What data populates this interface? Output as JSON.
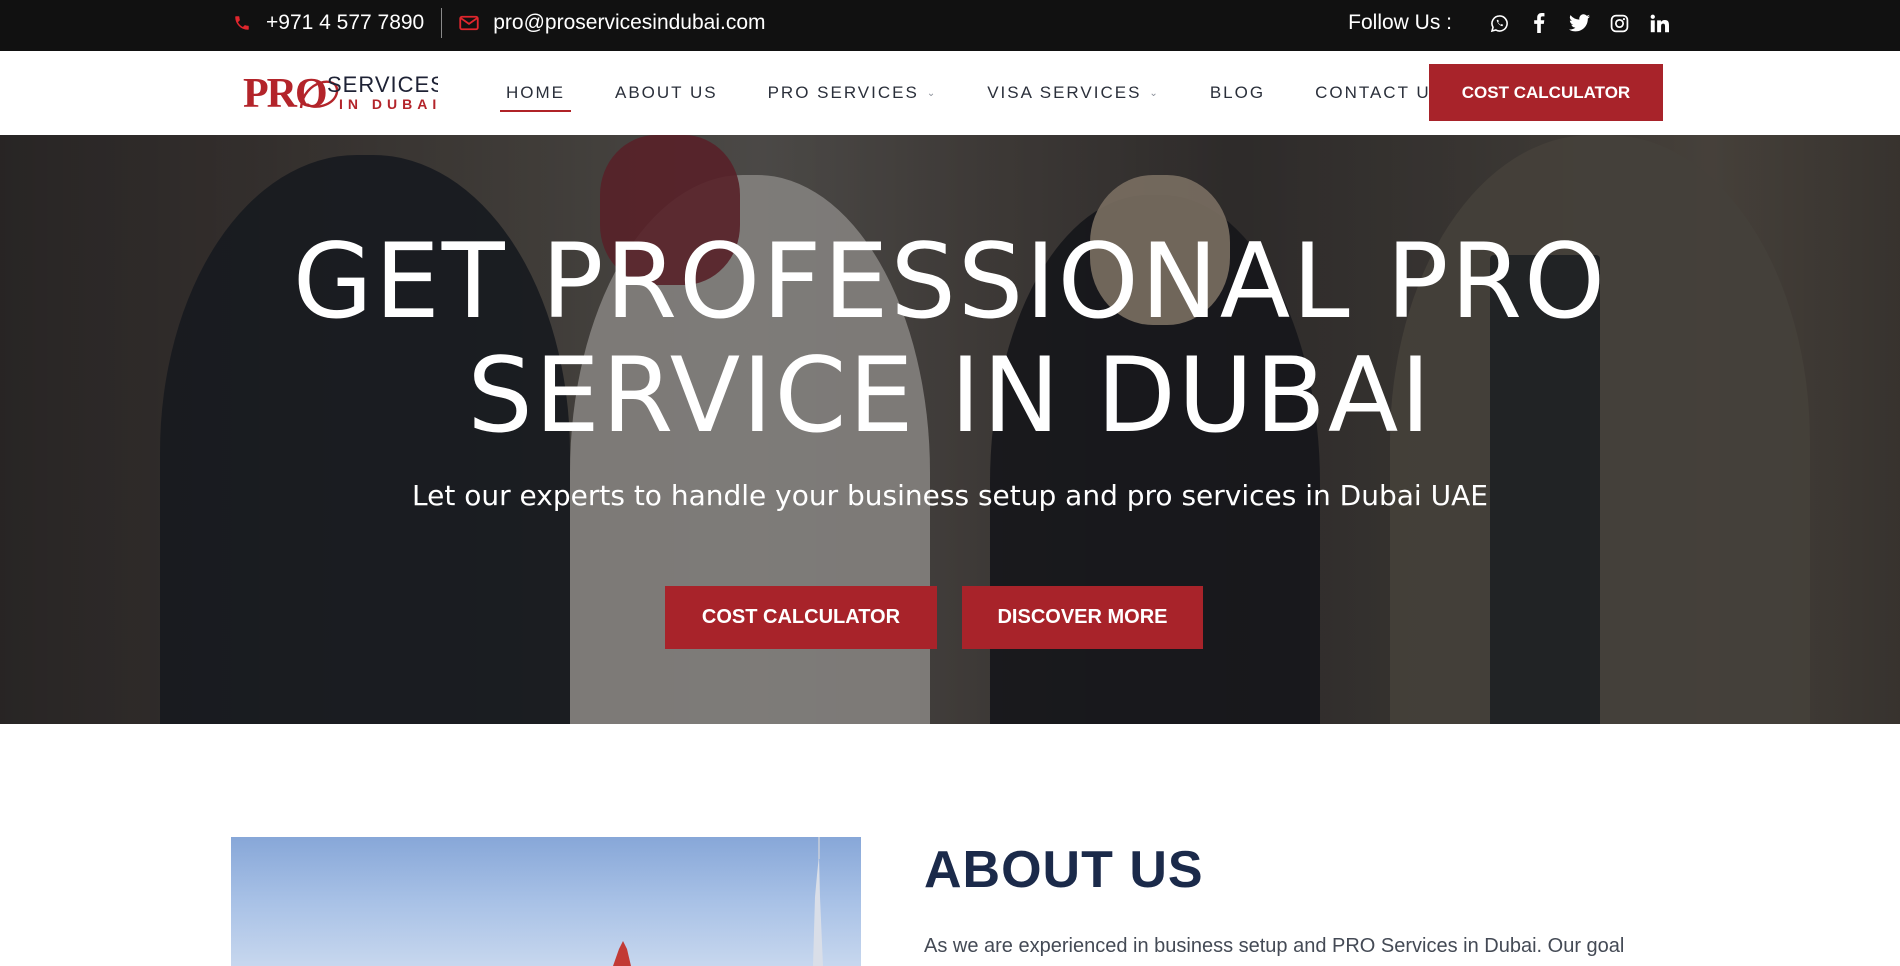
{
  "topbar": {
    "phone": "+971 4 577 7890",
    "email": "pro@proservicesindubai.com",
    "follow_label": "Follow Us :",
    "social_icons": [
      "whatsapp-icon",
      "facebook-icon",
      "twitter-icon",
      "instagram-icon",
      "linkedin-icon"
    ]
  },
  "logo": {
    "mark": "PRO",
    "line1": "SERVICES",
    "line2": "IN DUBAI"
  },
  "nav": {
    "items": [
      {
        "label": "HOME",
        "active": true
      },
      {
        "label": "ABOUT US"
      },
      {
        "label": "PRO SERVICES",
        "dropdown": true
      },
      {
        "label": "VISA SERVICES",
        "dropdown": true
      },
      {
        "label": "BLOG"
      },
      {
        "label": "CONTACT US"
      }
    ],
    "cta_label": "COST CALCULATOR"
  },
  "hero": {
    "title_line1": "GET PROFESSIONAL PRO",
    "title_line2": "SERVICE IN DUBAI",
    "subtitle": "Let our experts to handle your business setup and pro services in Dubai UAE",
    "button1": "COST CALCULATOR",
    "button2": "DISCOVER MORE"
  },
  "about": {
    "title": "ABOUT US",
    "text": "As we are experienced in business setup and PRO Services in Dubai. Our goal"
  },
  "colors": {
    "brand_red": "#a8232a",
    "topbar_bg": "#111111",
    "heading_navy": "#1b2a4a"
  }
}
